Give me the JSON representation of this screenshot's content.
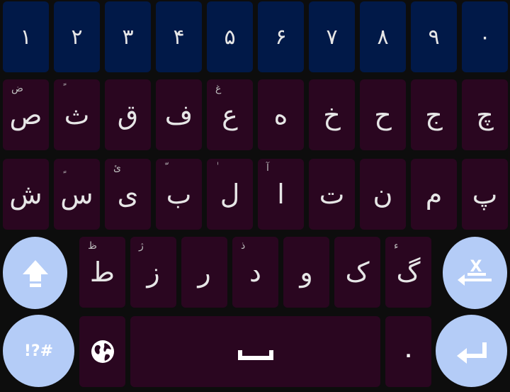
{
  "number_row": [
    "١",
    "٢",
    "٣",
    "۴",
    "۵",
    "۶",
    "٧",
    "٨",
    "٩",
    "٠"
  ],
  "row1": [
    {
      "label": "ص",
      "hint": "ض"
    },
    {
      "label": "ث",
      "hint": "ً"
    },
    {
      "label": "ق",
      "hint": ""
    },
    {
      "label": "ف",
      "hint": ""
    },
    {
      "label": "ع",
      "hint": "غ"
    },
    {
      "label": "ه",
      "hint": ""
    },
    {
      "label": "خ",
      "hint": ""
    },
    {
      "label": "ح",
      "hint": ""
    },
    {
      "label": "ج",
      "hint": ""
    },
    {
      "label": "چ",
      "hint": ""
    }
  ],
  "row2": [
    {
      "label": "ش",
      "hint": ""
    },
    {
      "label": "س",
      "hint": "ٍ"
    },
    {
      "label": "ی",
      "hint": "ئ"
    },
    {
      "label": "ب",
      "hint": "ّ"
    },
    {
      "label": "ل",
      "hint": "ٰ"
    },
    {
      "label": "ا",
      "hint": "آ"
    },
    {
      "label": "ت",
      "hint": ""
    },
    {
      "label": "ن",
      "hint": ""
    },
    {
      "label": "م",
      "hint": ""
    },
    {
      "label": "پ",
      "hint": ""
    }
  ],
  "row3": [
    {
      "label": "ط",
      "hint": "ظ"
    },
    {
      "label": "ز",
      "hint": "ژ"
    },
    {
      "label": "ر",
      "hint": ""
    },
    {
      "label": "د",
      "hint": "ذ"
    },
    {
      "label": "و",
      "hint": ""
    },
    {
      "label": "ک",
      "hint": ""
    },
    {
      "label": "گ",
      "hint": "ء"
    }
  ],
  "symbols_label": "!?#",
  "period_label": ".",
  "colors": {
    "number_key": "#011948",
    "letter_key": "#2a0620",
    "round_key": "#b4ccf7",
    "background": "#0d0d0d"
  },
  "icons": {
    "shift": "shift-arrow-icon",
    "delete": "backspace-x-icon",
    "language": "globe-icon",
    "space": "space-bar-icon",
    "enter": "enter-arrow-icon"
  }
}
